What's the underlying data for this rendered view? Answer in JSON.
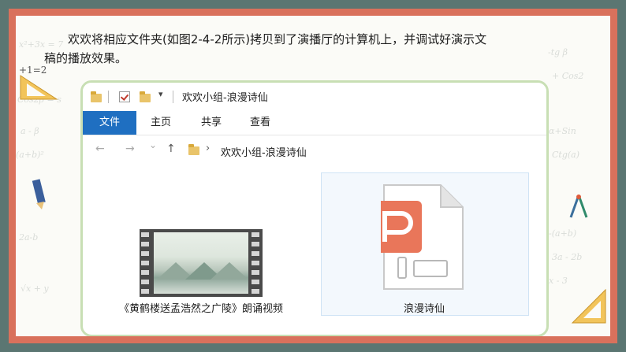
{
  "caption": {
    "line1": "欢欢将相应文件夹(如图2-4-2所示)拷贝到了演播厅的计算机上，并调试好演示文",
    "line2": "稿的播放效果。"
  },
  "side_equation": "+1=2",
  "explorer": {
    "window_title": "欢欢小组-浪漫诗仙",
    "ribbon_tabs": [
      "文件",
      "主页",
      "共享",
      "查看"
    ],
    "address_path": "欢欢小组-浪漫诗仙",
    "nav_symbols": {
      "back": "←",
      "forward": "→",
      "recent": "⌄",
      "up": "↑",
      "path_sep": "›",
      "qat_menu": "▾"
    },
    "files": [
      {
        "name": "《黄鹤楼送孟浩然之广陵》朗诵视频",
        "icon": "video-file-icon"
      },
      {
        "name": "浪漫诗仙",
        "icon": "presentation-file-icon"
      }
    ]
  },
  "colors": {
    "outer_frame": "#5b7672",
    "border_strip": "#d9715c",
    "card_border": "#c8dfb4",
    "ribbon_active": "#1f6fc1",
    "ppt_orange": "#e9765a"
  }
}
